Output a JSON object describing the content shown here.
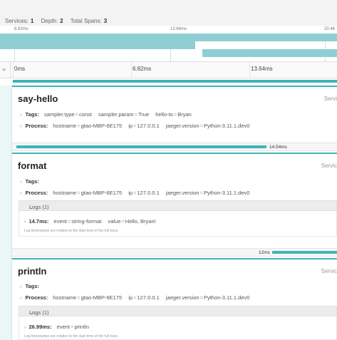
{
  "header": {
    "services_label": "Services:",
    "services_value": "1",
    "depth_label": "Depth:",
    "depth_value": "2",
    "spans_label": "Total Spans:",
    "spans_value": "3"
  },
  "minimap": {
    "ticks": [
      "6.82ms",
      "13.64ms",
      "20.46"
    ]
  },
  "timeline": {
    "collapse_icon": "double-chevron-right",
    "ticks": [
      "0ms",
      "6.82ms",
      "13.64ms"
    ]
  },
  "spans": [
    {
      "name": "say-hello",
      "service_text": "Servi",
      "tags_label": "Tags:",
      "tags": [
        {
          "k": "sampler.type",
          "v": "const"
        },
        {
          "k": "sampler.param",
          "v": "True"
        },
        {
          "k": "hello-to",
          "v": "Bryan"
        }
      ],
      "process_label": "Process:",
      "process": [
        {
          "k": "hostname",
          "v": "gtao-MBP-6E175"
        },
        {
          "k": "ip",
          "v": "127.0.0.1"
        },
        {
          "k": "jaeger.version",
          "v": "Python-3.11.1.dev0"
        }
      ],
      "duration": "14.54ms"
    },
    {
      "name": "format",
      "service_text": "Servic",
      "tags_label": "Tags:",
      "process_label": "Process:",
      "process": [
        {
          "k": "hostname",
          "v": "gtao-MBP-6E175"
        },
        {
          "k": "ip",
          "v": "127.0.0.1"
        },
        {
          "k": "jaeger.version",
          "v": "Python-3.11.1.dev0"
        }
      ],
      "logs_label": "Logs (1)",
      "log": {
        "ts": "14.7ms:",
        "fields": [
          {
            "k": "event",
            "v": "string-format"
          },
          {
            "k": "value",
            "v": "Hello, Bryan!"
          }
        ]
      },
      "log_note": "Log timestamps are relative to the start time of the full trace.",
      "duration": "12ms"
    },
    {
      "name": "println",
      "service_text": "Servic",
      "tags_label": "Tags:",
      "process_label": "Process:",
      "process": [
        {
          "k": "hostname",
          "v": "gtao-MBP-6E175"
        },
        {
          "k": "ip",
          "v": "127.0.0.1"
        },
        {
          "k": "jaeger.version",
          "v": "Python-3.11.1.dev0"
        }
      ],
      "logs_label": "Logs (1)",
      "log": {
        "ts": "26.99ms:",
        "fields": [
          {
            "k": "event",
            "v": "println"
          }
        ]
      },
      "log_note": "Log timestamps are relative to the start time of the full trace."
    }
  ]
}
